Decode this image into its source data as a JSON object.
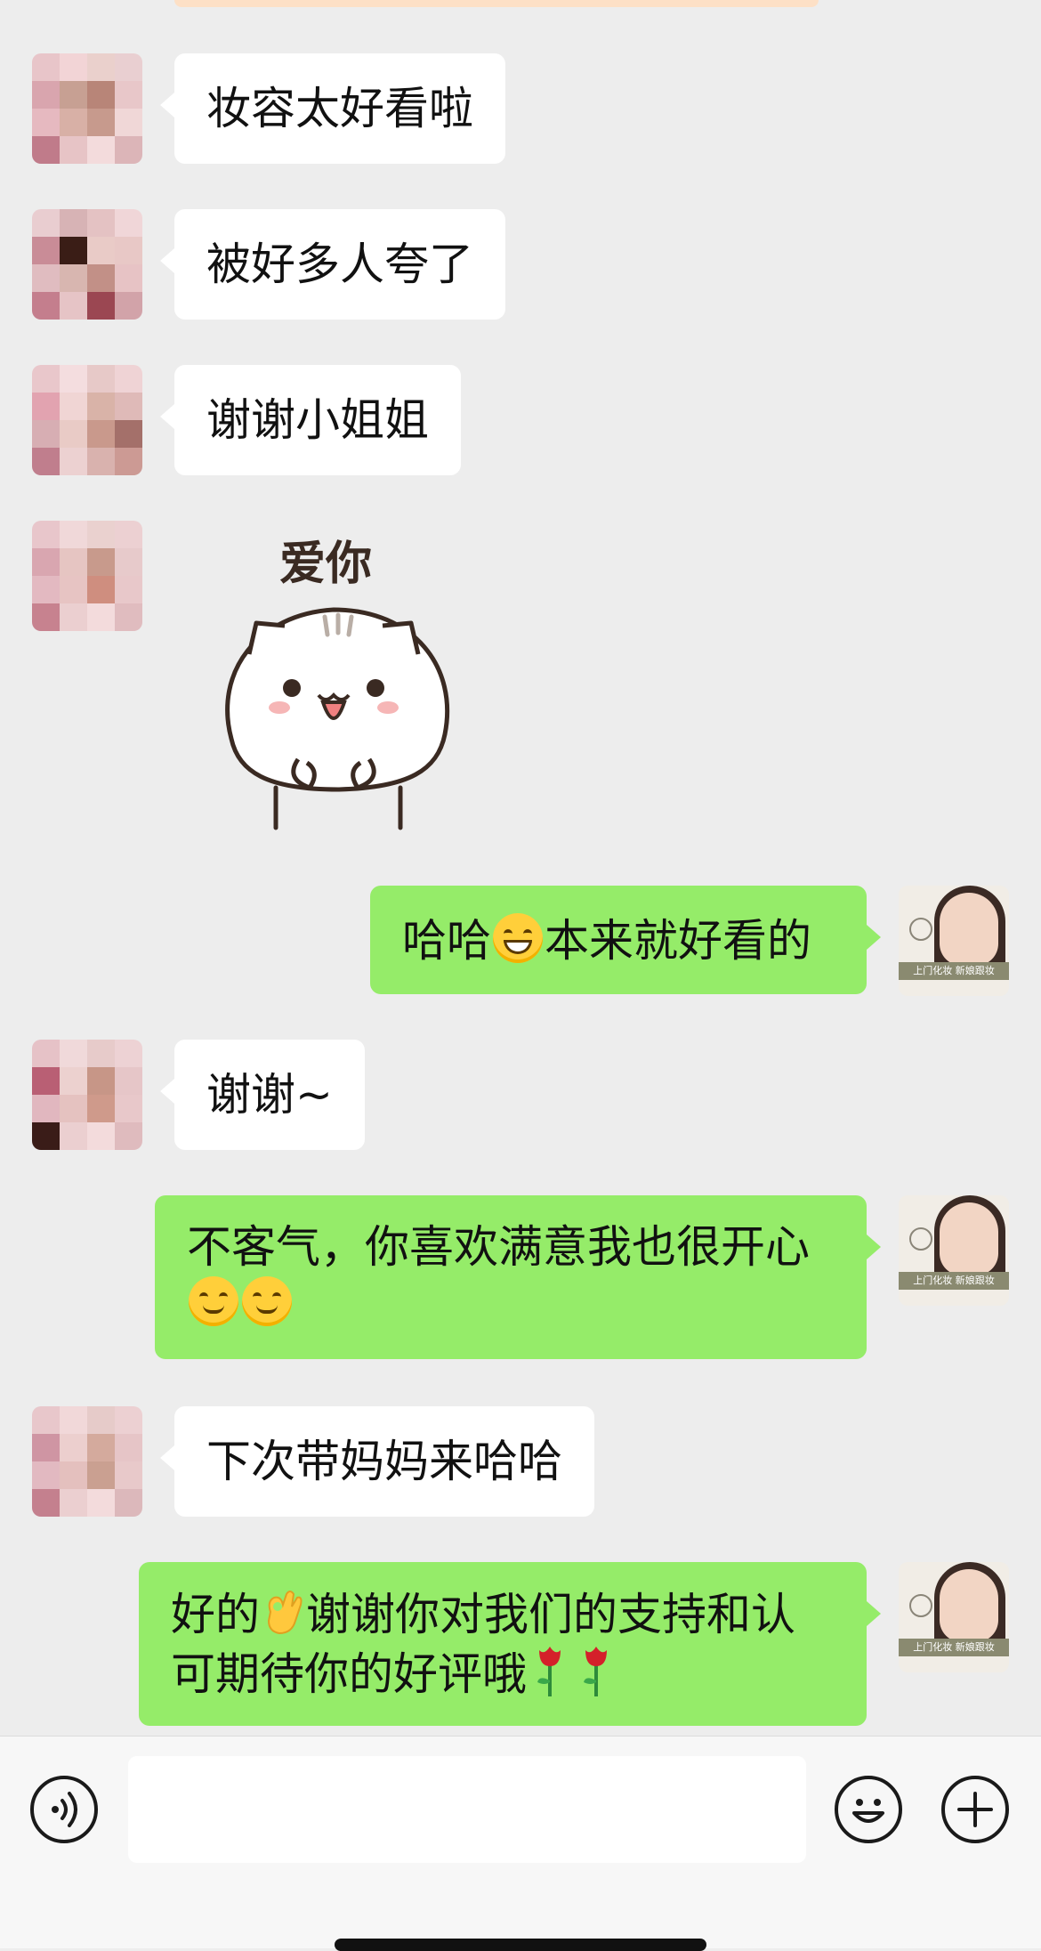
{
  "messages": [
    {
      "side": "left",
      "text": "妆容太好看啦"
    },
    {
      "side": "left",
      "text": "被好多人夸了"
    },
    {
      "side": "left",
      "text": "谢谢小姐姐"
    },
    {
      "side": "left",
      "sticker_text": "爱你"
    },
    {
      "side": "right",
      "text_a": "哈哈",
      "emoji": "grinning-face",
      "text_b": "本来就好看的"
    },
    {
      "side": "left",
      "text": "谢谢~"
    },
    {
      "side": "right",
      "line1": "不客气，你喜欢满意我也很开心",
      "emojis": [
        "smiling-face-blush",
        "smiling-face-blush"
      ]
    },
    {
      "side": "left",
      "text": "下次带妈妈来哈哈"
    },
    {
      "side": "right",
      "line1_a": "好的",
      "emoji": "ok-hand",
      "line1_b": "谢谢你对我们的支持和认",
      "line2": "可期待你的好评哦",
      "emojis": [
        "rose",
        "rose"
      ]
    }
  ],
  "brand_avatar_caption": "上门化妆 新娘跟妆",
  "input_bar": {
    "voice_icon": "voice-icon",
    "emoji_icon": "emoji-icon",
    "plus_icon": "plus-icon",
    "input_value": ""
  },
  "colors": {
    "outgoing_bubble": "#95ec69",
    "incoming_bubble": "#ffffff",
    "background": "#ededed"
  }
}
